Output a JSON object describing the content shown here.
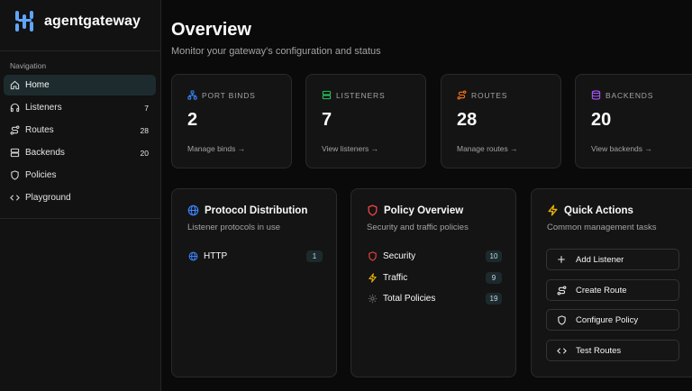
{
  "app": {
    "brand": "agentgateway"
  },
  "sidebar": {
    "heading": "Navigation",
    "items": [
      {
        "label": "Home",
        "count": "",
        "icon": "home-icon"
      },
      {
        "label": "Listeners",
        "count": "7",
        "icon": "headphones-icon"
      },
      {
        "label": "Routes",
        "count": "28",
        "icon": "route-icon"
      },
      {
        "label": "Backends",
        "count": "20",
        "icon": "server-icon"
      },
      {
        "label": "Policies",
        "count": "",
        "icon": "shield-icon"
      },
      {
        "label": "Playground",
        "count": "",
        "icon": "code-icon"
      }
    ]
  },
  "main": {
    "title": "Overview",
    "subtitle": "Monitor your gateway's configuration and status"
  },
  "stats": [
    {
      "label": "PORT BINDS",
      "value": "2",
      "link": "Manage binds →",
      "icon": "network-icon",
      "color": "#3b82f6"
    },
    {
      "label": "LISTENERS",
      "value": "7",
      "link": "View listeners →",
      "icon": "server-icon",
      "color": "#22c55e"
    },
    {
      "label": "ROUTES",
      "value": "28",
      "link": "Manage routes →",
      "icon": "route-icon",
      "color": "#f97316"
    },
    {
      "label": "BACKENDS",
      "value": "20",
      "link": "View backends →",
      "icon": "database-icon",
      "color": "#a855f7"
    }
  ],
  "protocol": {
    "title": "Protocol Distribution",
    "subtitle": "Listener protocols in use",
    "rows": [
      {
        "label": "HTTP",
        "count": "1",
        "icon": "globe-icon"
      }
    ]
  },
  "policy": {
    "title": "Policy Overview",
    "subtitle": "Security and traffic policies",
    "rows": [
      {
        "label": "Security",
        "count": "10",
        "icon": "shield-icon"
      },
      {
        "label": "Traffic",
        "count": "9",
        "icon": "zap-icon"
      },
      {
        "label": "Total Policies",
        "count": "19",
        "icon": "gear-icon"
      }
    ]
  },
  "quick": {
    "title": "Quick Actions",
    "subtitle": "Common management tasks",
    "actions": [
      {
        "label": "Add Listener",
        "icon": "plus-icon"
      },
      {
        "label": "Create Route",
        "icon": "route-icon"
      },
      {
        "label": "Configure Policy",
        "icon": "shield-icon"
      },
      {
        "label": "Test Routes",
        "icon": "code-icon"
      }
    ]
  },
  "colors": {
    "accent": "#3b82f6",
    "danger": "#ef4444",
    "warning": "#eab308",
    "background": "#0a0a0a",
    "card": "#141414"
  }
}
